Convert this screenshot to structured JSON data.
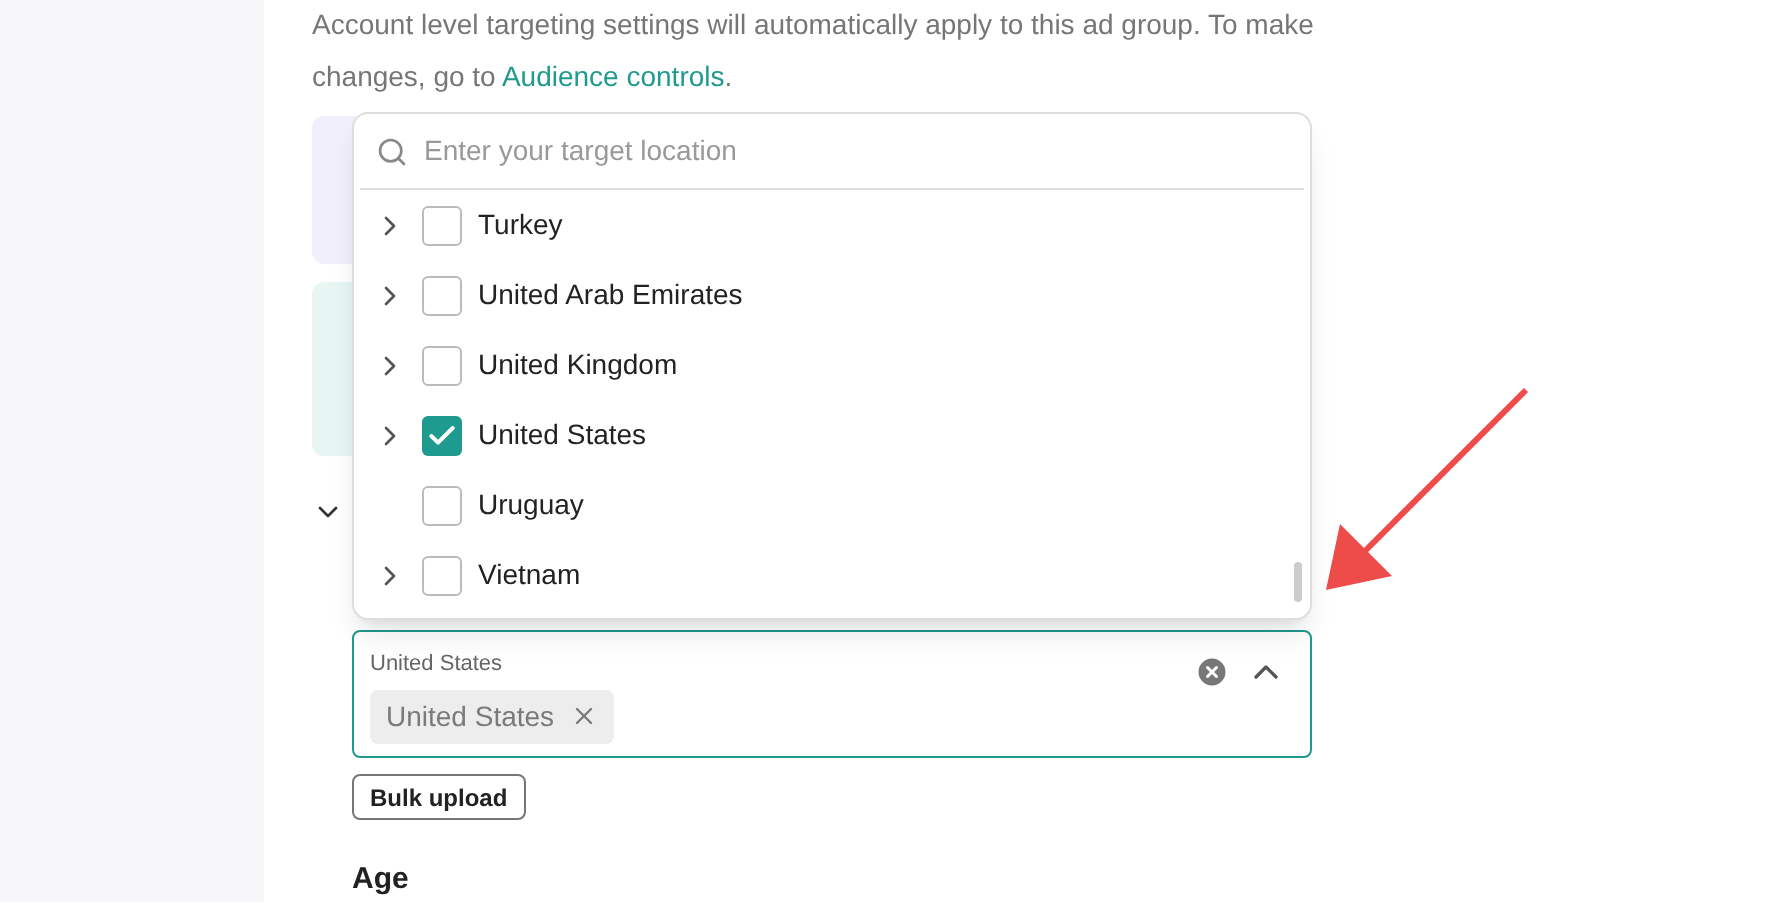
{
  "notice": {
    "text": "Account level targeting settings will automatically apply to this ad group. To make changes, go to ",
    "link": "Audience controls",
    "end": "."
  },
  "dropdown": {
    "placeholder": "Enter your target location",
    "items": [
      {
        "label": "Turkey",
        "expandable": true,
        "checked": false
      },
      {
        "label": "United Arab Emirates",
        "expandable": true,
        "checked": false
      },
      {
        "label": "United Kingdom",
        "expandable": true,
        "checked": false
      },
      {
        "label": "United States",
        "expandable": true,
        "checked": true
      },
      {
        "label": "Uruguay",
        "expandable": false,
        "checked": false
      },
      {
        "label": "Vietnam",
        "expandable": true,
        "checked": false
      }
    ]
  },
  "location_field": {
    "label": "United States",
    "tags": [
      "United States"
    ],
    "expanded": true
  },
  "bulk_upload": "Bulk upload",
  "section_title": "Age"
}
